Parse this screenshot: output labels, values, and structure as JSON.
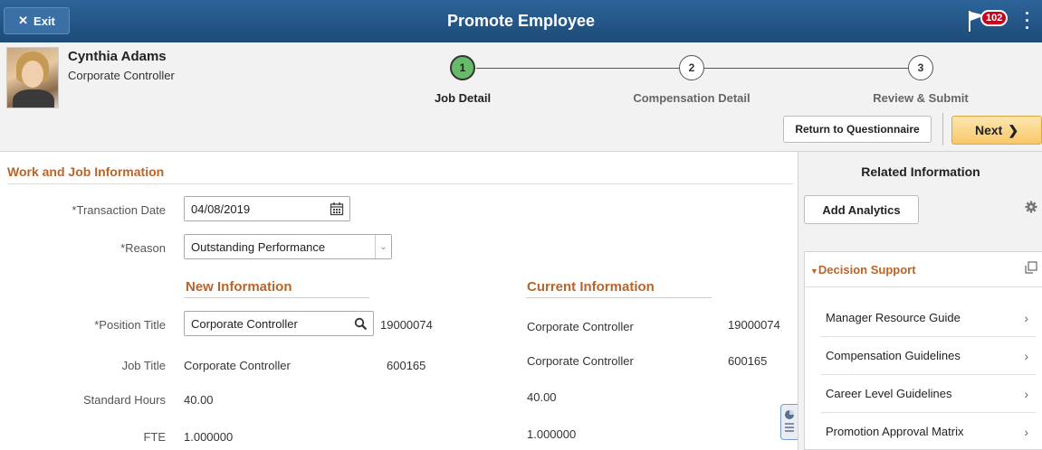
{
  "banner": {
    "exit_label": "Exit",
    "title": "Promote Employee",
    "notification_count": "102"
  },
  "employee": {
    "name": "Cynthia Adams",
    "role": "Corporate Controller"
  },
  "steps": [
    {
      "number": "1",
      "label": "Job Detail"
    },
    {
      "number": "2",
      "label": "Compensation Detail"
    },
    {
      "number": "3",
      "label": "Review & Submit"
    }
  ],
  "actions": {
    "return_label": "Return to Questionnaire",
    "next_label": "Next"
  },
  "form": {
    "section_title": "Work and Job Information",
    "transaction_date_label": "*Transaction Date",
    "transaction_date_value": "04/08/2019",
    "reason_label": "*Reason",
    "reason_value": "Outstanding Performance",
    "new_info_title": "New Information",
    "current_info_title": "Current Information",
    "position_title_label": "*Position Title",
    "job_title_label": "Job Title",
    "standard_hours_label": "Standard Hours",
    "fte_label": "FTE",
    "new": {
      "position_title": "Corporate Controller",
      "position_number": "19000074",
      "job_title": "Corporate Controller",
      "job_code": "600165",
      "standard_hours": "40.00",
      "fte": "1.000000"
    },
    "current": {
      "position_title": "Corporate Controller",
      "position_number": "19000074",
      "job_title": "Corporate Controller",
      "job_code": "600165",
      "standard_hours": "40.00",
      "fte": "1.000000"
    }
  },
  "related": {
    "title": "Related Information",
    "add_analytics_label": "Add Analytics",
    "tile_title": "Decision Support",
    "links": [
      "Manager Resource Guide",
      "Compensation Guidelines",
      "Career Level Guidelines",
      "Promotion Approval Matrix"
    ]
  },
  "colors": {
    "banner": "#1d4a78",
    "accent": "#b9652a",
    "active_step": "#66bb6a",
    "next_button": "#f8c86a",
    "badge": "#d0021b"
  },
  "icons": {
    "exit": "close-icon",
    "notifications": "flag-icon",
    "menu": "kebab-menu-icon",
    "calendar": "calendar-icon",
    "search": "search-icon",
    "dropdown": "chevron-down-icon",
    "next": "chevron-right-icon",
    "settings": "gear-icon",
    "expand": "expand-icon",
    "pivot": "pie-chart-icon"
  }
}
